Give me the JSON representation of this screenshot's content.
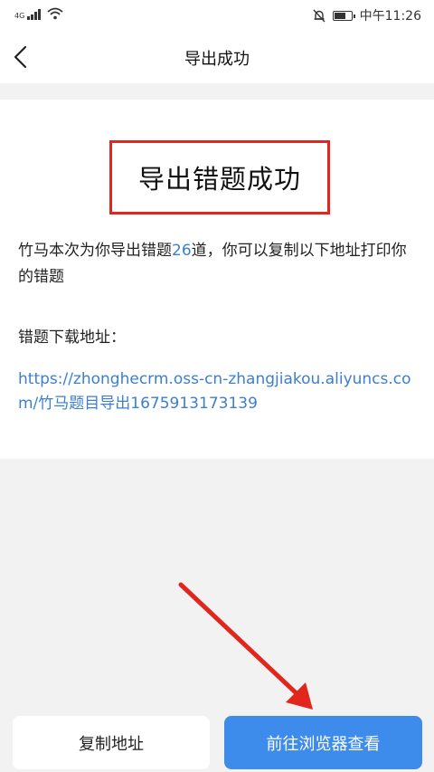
{
  "status_bar": {
    "network": "4G",
    "time": "中午11:26",
    "icons": [
      "signal-icon",
      "wifi-icon",
      "mute-bell-icon",
      "battery-icon"
    ]
  },
  "nav": {
    "title": "导出成功",
    "back_icon": "chevron-left-icon"
  },
  "content": {
    "headline": "导出错题成功",
    "desc_before": "竹马本次为你导出错题",
    "count": "26",
    "desc_after": "道，你可以复制以下地址打印你的错题",
    "download_label": "错题下载地址：",
    "download_url": "https://zhonghecrm.oss-cn-zhangjiakou.aliyuncs.com/竹马题目导出1675913173139"
  },
  "buttons": {
    "copy": "复制地址",
    "open_browser": "前往浏览器查看"
  },
  "colors": {
    "accent": "#3d8bea",
    "link": "#3b7fcf",
    "highlight_box": "#e0261d",
    "background": "#f2f2f2"
  }
}
